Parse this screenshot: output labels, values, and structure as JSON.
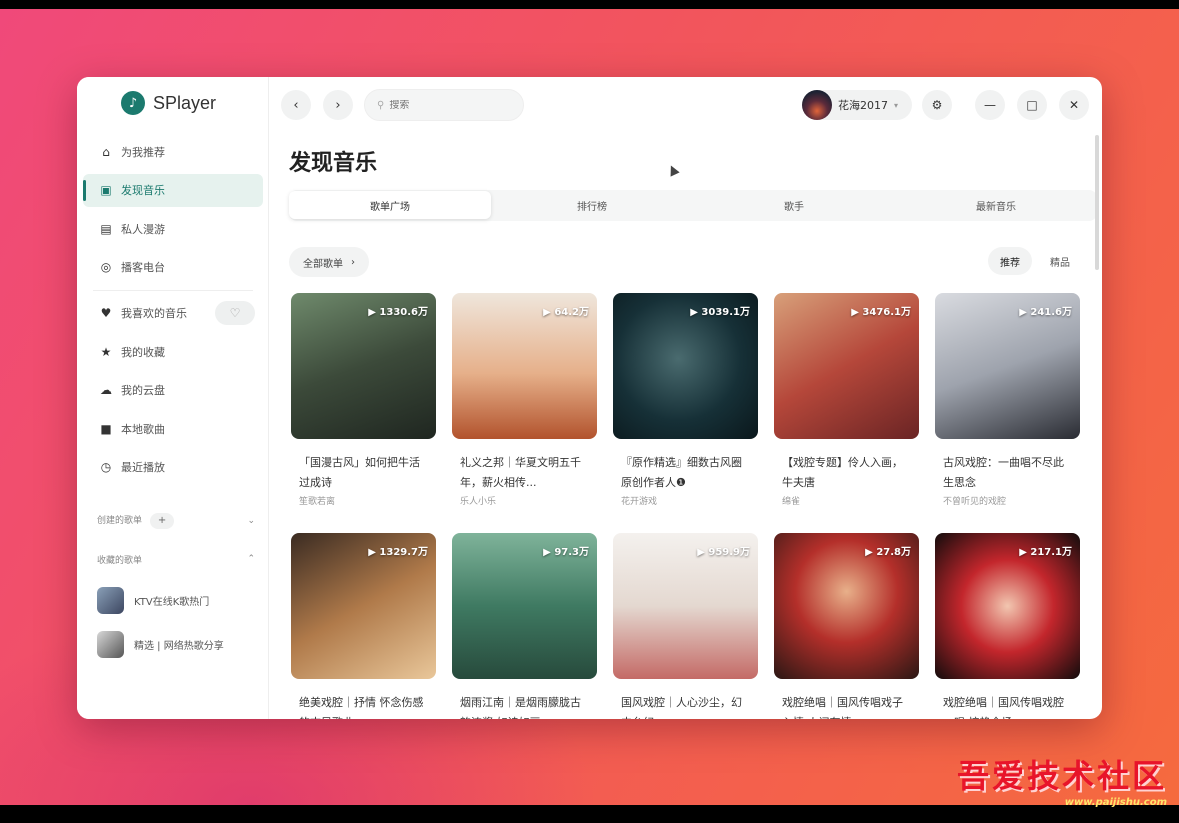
{
  "app": {
    "name": "SPlayer"
  },
  "sidebar": {
    "nav": [
      {
        "label": "为我推荐",
        "icon": "home-icon"
      },
      {
        "label": "发现音乐",
        "icon": "discover-icon",
        "active": true
      },
      {
        "label": "私人漫游",
        "icon": "radio-icon"
      },
      {
        "label": "播客电台",
        "icon": "podcast-icon"
      }
    ],
    "library": [
      {
        "label": "我喜欢的音乐",
        "icon": "heart-icon"
      },
      {
        "label": "我的收藏",
        "icon": "star-icon"
      },
      {
        "label": "我的云盘",
        "icon": "cloud-icon"
      },
      {
        "label": "本地歌曲",
        "icon": "folder-icon"
      },
      {
        "label": "最近播放",
        "icon": "history-icon"
      }
    ],
    "created_section": {
      "label": "创建的歌单",
      "plus": "+"
    },
    "collected_section": {
      "label": "收藏的歌单"
    },
    "playlists": [
      {
        "label": "KTV在线K歌热门"
      },
      {
        "label": "精选 | 网络热歌分享"
      }
    ]
  },
  "topbar": {
    "search_placeholder": "搜索",
    "username": "花海2017",
    "dropdown_caret": "▾"
  },
  "page": {
    "title": "发现音乐",
    "tabs": [
      "歌单广场",
      "排行榜",
      "歌手",
      "最新音乐"
    ],
    "filter_label": "全部歌单",
    "sort": [
      "推荐",
      "精品"
    ]
  },
  "playlists_grid": [
    {
      "count": "▶ 1330.6万",
      "title": "「国漫古风」如何把牛活过成诗",
      "creator": "笙歌若离"
    },
    {
      "count": "▶ 64.2万",
      "title": "礼义之邦｜华夏文明五千年，薪火相传...",
      "creator": "乐人小乐"
    },
    {
      "count": "▶ 3039.1万",
      "title": "『原作精选』细数古风圈原创作者人❶",
      "creator": "花开游戏"
    },
    {
      "count": "▶ 3476.1万",
      "title": "【戏腔专题】伶人入画，牛夫唐",
      "creator": "绵雀"
    },
    {
      "count": "▶ 241.6万",
      "title": "古风戏腔：一曲唱不尽此生思念",
      "creator": "不曾听见的戏腔"
    },
    {
      "count": "▶ 1329.7万",
      "title": "绝美戏腔｜抒情 怀念伤感的古风歌曲",
      "creator": ""
    },
    {
      "count": "▶ 97.3万",
      "title": "烟雨江南｜是烟雨朦胧古韵浓酱 如诗如画",
      "creator": ""
    },
    {
      "count": "▶ 959.9万",
      "title": "国风戏腔｜人心沙尘，幻中台幻",
      "creator": ""
    },
    {
      "count": "▶ 27.8万",
      "title": "戏腔绝唱｜国风传唱戏子入情 人间有情",
      "creator": ""
    },
    {
      "count": "▶ 217.1万",
      "title": "戏腔绝唱｜国风传唱戏腔一唱 惊艳全场",
      "creator": ""
    }
  ],
  "watermark": {
    "main": "吾爱技术社区",
    "url": "www.paijishu.com"
  }
}
